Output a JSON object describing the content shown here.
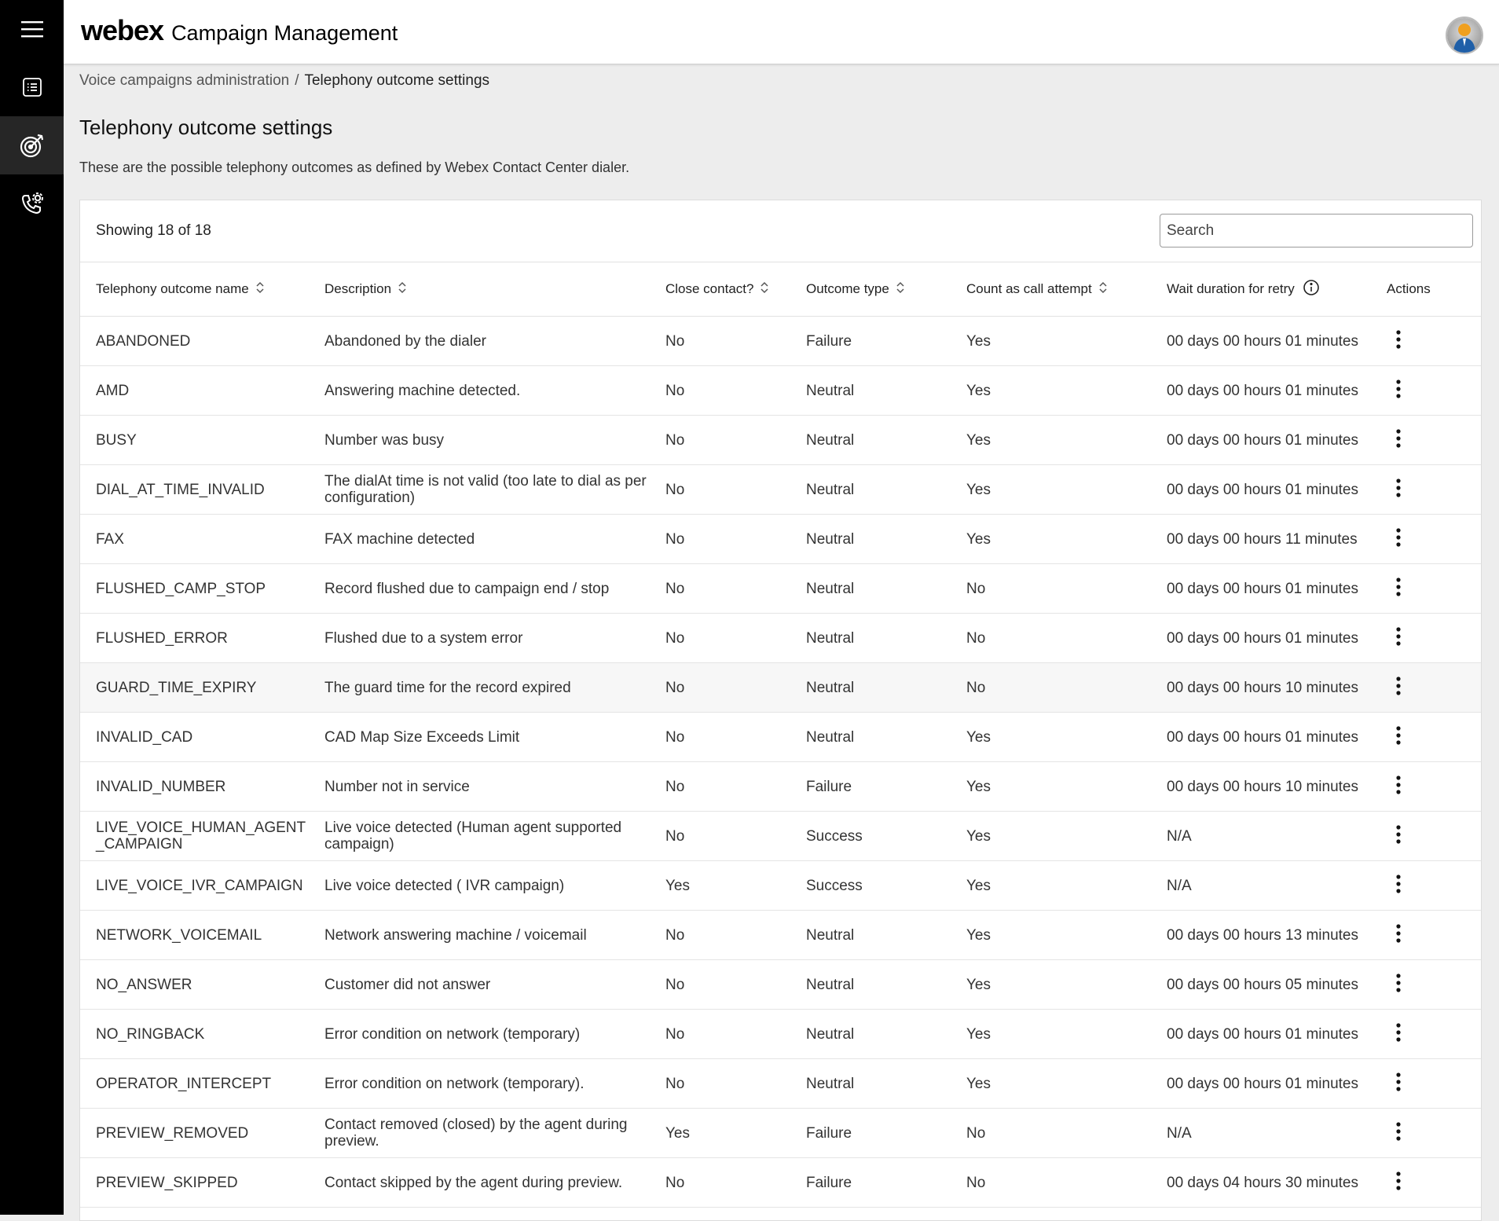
{
  "brand": {
    "logo": "webex",
    "product": "Campaign Management"
  },
  "nav": [
    {
      "name": "menu-icon"
    },
    {
      "name": "list-icon"
    },
    {
      "name": "target-icon"
    },
    {
      "name": "phone-settings-icon"
    }
  ],
  "breadcrumb": {
    "parent": "Voice campaigns administration",
    "separator": "/",
    "current": "Telephony outcome settings"
  },
  "page": {
    "title": "Telephony outcome settings",
    "description": "These are the possible telephony outcomes as defined by Webex Contact Center dialer."
  },
  "table": {
    "showing": "Showing 18 of 18",
    "search_placeholder": "Search",
    "columns": [
      "Telephony outcome name",
      "Description",
      "Close contact?",
      "Outcome type",
      "Count as call attempt",
      "Wait duration for retry",
      "Actions"
    ],
    "rows": [
      {
        "name": "ABANDONED",
        "description": "Abandoned by the dialer",
        "close": "No",
        "type": "Failure",
        "count": "Yes",
        "wait": "00 days 00 hours 01 minutes"
      },
      {
        "name": "AMD",
        "description": "Answering machine detected.",
        "close": "No",
        "type": "Neutral",
        "count": "Yes",
        "wait": "00 days 00 hours 01 minutes"
      },
      {
        "name": "BUSY",
        "description": "Number was busy",
        "close": "No",
        "type": "Neutral",
        "count": "Yes",
        "wait": "00 days 00 hours 01 minutes"
      },
      {
        "name": "DIAL_AT_TIME_INVALID",
        "description": "The dialAt time is not valid (too late to dial as per configuration)",
        "close": "No",
        "type": "Neutral",
        "count": "Yes",
        "wait": "00 days 00 hours 01 minutes"
      },
      {
        "name": "FAX",
        "description": "FAX machine detected",
        "close": "No",
        "type": "Neutral",
        "count": "Yes",
        "wait": "00 days 00 hours 11 minutes"
      },
      {
        "name": "FLUSHED_CAMP_STOP",
        "description": "Record flushed due to campaign end / stop",
        "close": "No",
        "type": "Neutral",
        "count": "No",
        "wait": "00 days 00 hours 01 minutes"
      },
      {
        "name": "FLUSHED_ERROR",
        "description": "Flushed due to a system error",
        "close": "No",
        "type": "Neutral",
        "count": "No",
        "wait": "00 days 00 hours 01 minutes"
      },
      {
        "name": "GUARD_TIME_EXPIRY",
        "description": "The guard time for the record expired",
        "close": "No",
        "type": "Neutral",
        "count": "No",
        "wait": "00 days 00 hours 10 minutes"
      },
      {
        "name": "INVALID_CAD",
        "description": "CAD Map Size Exceeds Limit",
        "close": "No",
        "type": "Neutral",
        "count": "Yes",
        "wait": "00 days 00 hours 01 minutes"
      },
      {
        "name": "INVALID_NUMBER",
        "description": "Number not in service",
        "close": "No",
        "type": "Failure",
        "count": "Yes",
        "wait": "00 days 00 hours 10 minutes"
      },
      {
        "name": "LIVE_VOICE_HUMAN_AGENT_CAMPAIGN",
        "description": "Live voice detected (Human agent supported campaign)",
        "close": "No",
        "type": "Success",
        "count": "Yes",
        "wait": "N/A"
      },
      {
        "name": "LIVE_VOICE_IVR_CAMPAIGN",
        "description": "Live voice detected ( IVR campaign)",
        "close": "Yes",
        "type": "Success",
        "count": "Yes",
        "wait": "N/A"
      },
      {
        "name": "NETWORK_VOICEMAIL",
        "description": "Network answering machine / voicemail",
        "close": "No",
        "type": "Neutral",
        "count": "Yes",
        "wait": "00 days 00 hours 13 minutes"
      },
      {
        "name": "NO_ANSWER",
        "description": "Customer did not answer",
        "close": "No",
        "type": "Neutral",
        "count": "Yes",
        "wait": "00 days 00 hours 05 minutes"
      },
      {
        "name": "NO_RINGBACK",
        "description": "Error condition on network (temporary)",
        "close": "No",
        "type": "Neutral",
        "count": "Yes",
        "wait": "00 days 00 hours 01 minutes"
      },
      {
        "name": "OPERATOR_INTERCEPT",
        "description": "Error condition on network (temporary).",
        "close": "No",
        "type": "Neutral",
        "count": "Yes",
        "wait": "00 days 00 hours 01 minutes"
      },
      {
        "name": "PREVIEW_REMOVED",
        "description": "Contact removed (closed) by the agent during preview.",
        "close": "Yes",
        "type": "Failure",
        "count": "No",
        "wait": "N/A"
      },
      {
        "name": "PREVIEW_SKIPPED",
        "description": "Contact skipped by the agent during preview.",
        "close": "No",
        "type": "Failure",
        "count": "No",
        "wait": "00 days 04 hours 30 minutes"
      }
    ]
  }
}
